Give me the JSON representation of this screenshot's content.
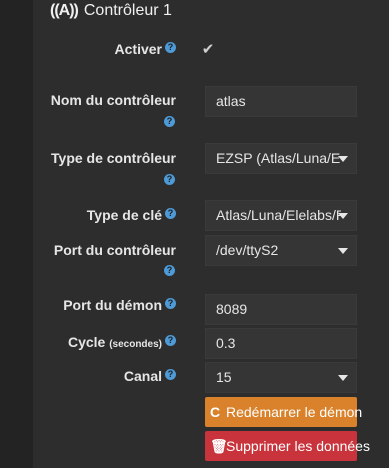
{
  "header": {
    "title": "Contrôleur 1",
    "icon": "broadcast-icon",
    "icon_glyph": "((A))"
  },
  "help_glyph": "?",
  "fields": {
    "enable": {
      "label": "Activer",
      "checked": true
    },
    "name": {
      "label": "Nom du contrôleur",
      "value": "atlas"
    },
    "type": {
      "label": "Type de contrôleur",
      "value": "EZSP (Atlas/Luna/Elelabs/Popp)"
    },
    "key_type": {
      "label": "Type de clé",
      "value": "Atlas/Luna/Elelabs/Popp"
    },
    "port": {
      "label": "Port du contrôleur",
      "value": "/dev/ttyS2"
    },
    "daemon_port": {
      "label": "Port du démon",
      "value": "8089"
    },
    "cycle": {
      "label": "Cycle",
      "label_small": "(secondes)",
      "value": "0.3"
    },
    "channel": {
      "label": "Canal",
      "value": "15"
    }
  },
  "buttons": {
    "restart": {
      "label": "Redémarrer le démon",
      "icon": "refresh-icon",
      "glyph": "C"
    },
    "delete": {
      "label": "Supprimer les données",
      "icon": "trash-icon",
      "glyph": "🗑"
    }
  },
  "colors": {
    "accent_help": "#4d9ad6",
    "restart": "#d9822b",
    "delete": "#c9333b"
  }
}
